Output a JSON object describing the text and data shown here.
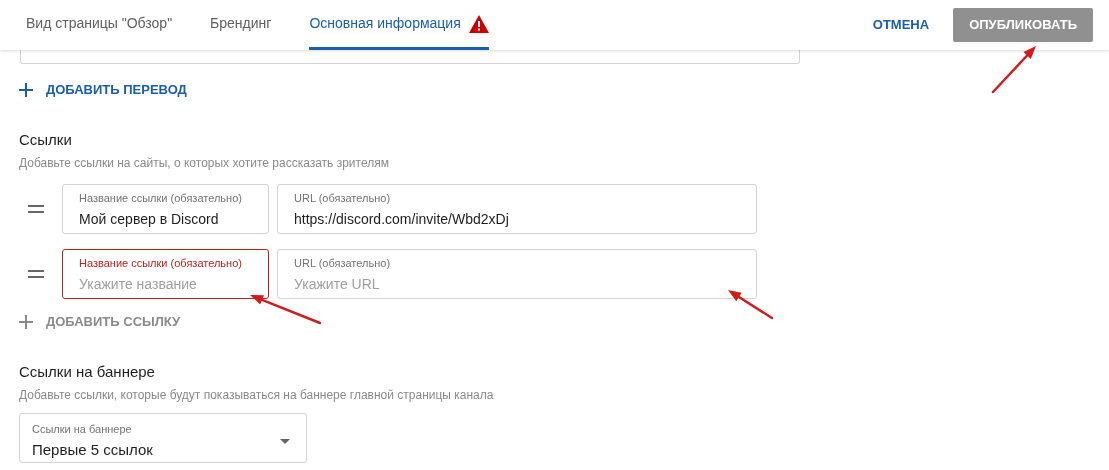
{
  "tabs": [
    {
      "label": "Вид страницы \"Обзор\"",
      "selected": false,
      "warning": false
    },
    {
      "label": "Брендинг",
      "selected": false,
      "warning": false
    },
    {
      "label": "Основная информация",
      "selected": true,
      "warning": true
    }
  ],
  "header_actions": {
    "cancel": "ОТМЕНА",
    "publish": "ОПУБЛИКОВАТЬ"
  },
  "add_translation": {
    "label": "ДОБАВИТЬ ПЕРЕВОД",
    "disabled": false
  },
  "links_section": {
    "title": "Ссылки",
    "description": "Добавьте ссылки на сайты, о которых хотите рассказать зрителям",
    "rows": [
      {
        "name_field": {
          "label": "Название ссылки (обязательно)",
          "value": "Мой сервер в Discord",
          "error": false
        },
        "url_field": {
          "label": "URL (обязательно)",
          "value": "https://discord.com/invite/Wbd2xDj",
          "error": false
        }
      },
      {
        "name_field": {
          "label": "Название ссылки (обязательно)",
          "placeholder": "Укажите название",
          "error": true
        },
        "url_field": {
          "label": "URL (обязательно)",
          "placeholder": "Укажите URL",
          "error": false
        }
      }
    ],
    "add_link": {
      "label": "ДОБАВИТЬ ССЫЛКУ",
      "disabled": true
    }
  },
  "banner_section": {
    "title": "Ссылки на баннере",
    "description": "Добавьте ссылки, которые будут показываться на баннере главной страницы канала",
    "select": {
      "label": "Ссылки на баннере",
      "value": "Первые 5 ссылок"
    }
  }
}
